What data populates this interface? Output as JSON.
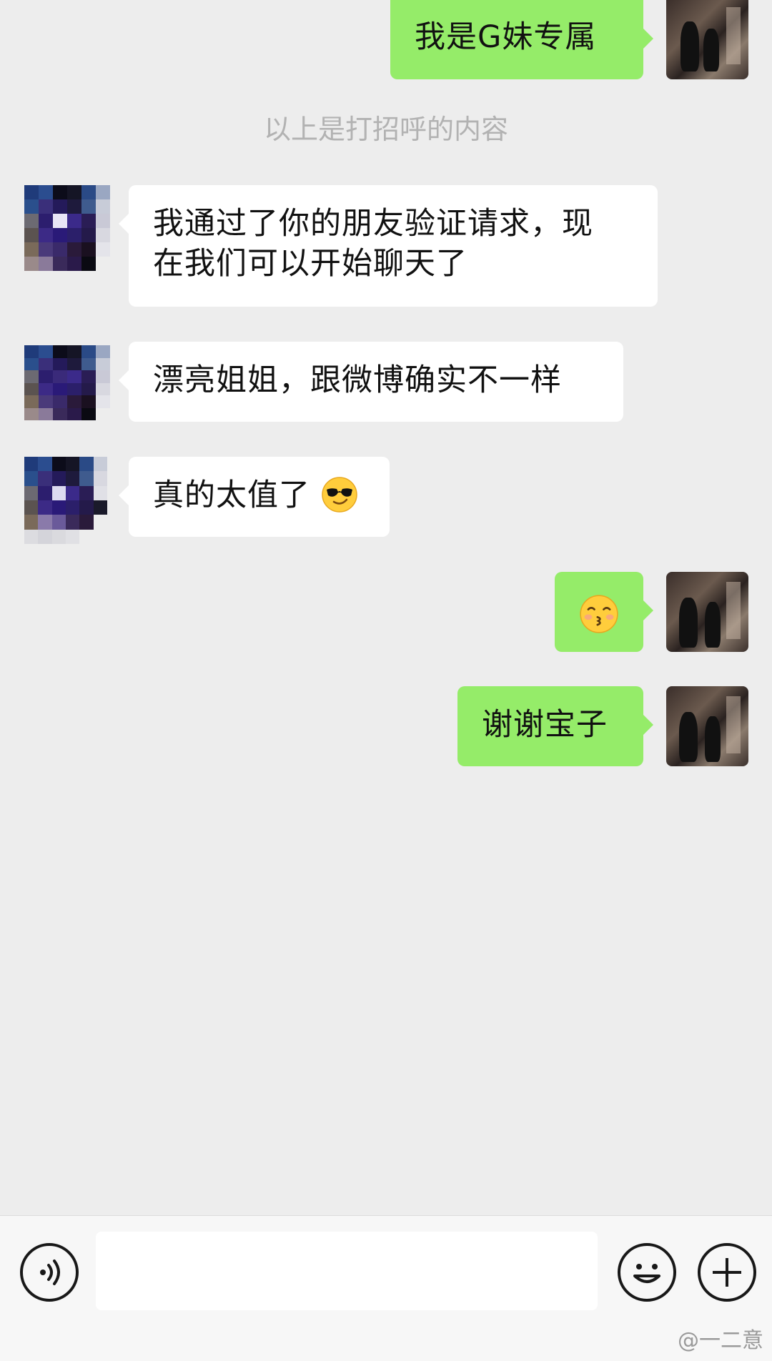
{
  "chat": {
    "system_note": "以上是打招呼的内容",
    "messages": [
      {
        "side": "sent",
        "text": "我是G妹专属"
      },
      {
        "side": "received",
        "text": "我通过了你的朋友验证请求，现在我们可以开始聊天了"
      },
      {
        "side": "received",
        "text": "漂亮姐姐，跟微博确实不一样"
      },
      {
        "side": "received",
        "text": "真的太值了",
        "emoji": "sunglasses-face"
      },
      {
        "side": "sent",
        "text": "",
        "emoji": "kissing-face"
      },
      {
        "side": "sent",
        "text": "谢谢宝子"
      }
    ],
    "line1": "我通过了你的朋友验证请求，现",
    "line2": "在我们可以开始聊天了"
  },
  "input": {
    "value": "",
    "icons": [
      "voice-icon",
      "emoji-icon",
      "plus-icon"
    ]
  },
  "watermark": "@一二意",
  "colors": {
    "background": "#ededed",
    "sent_bubble": "#95ec69",
    "received_bubble": "#ffffff",
    "system_text": "#b2b2b2"
  }
}
